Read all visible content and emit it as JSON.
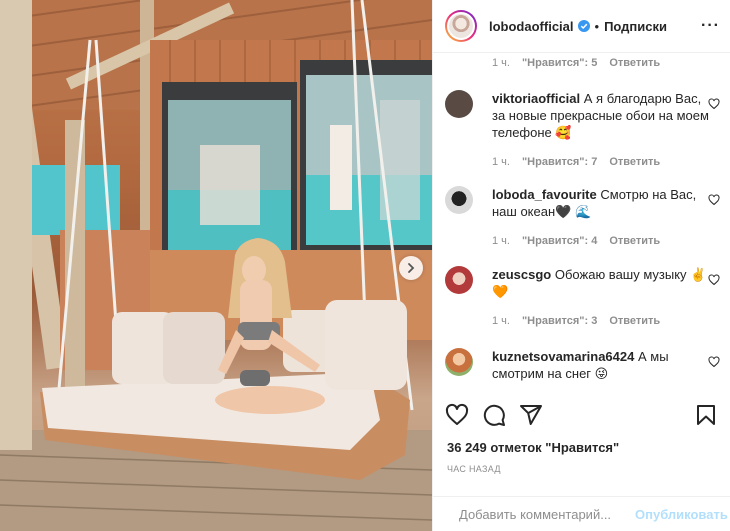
{
  "post": {
    "username": "lobodaofficial",
    "separator": "•",
    "follow_label": "Подписки",
    "more_label": "···"
  },
  "first_comment_meta": {
    "time": "1 ч.",
    "likes": "\"Нравится\": 5",
    "reply": "Ответить"
  },
  "comments": [
    {
      "username": "viktoriaofficial",
      "text": "А я благодарю Вас, за новые прекрасные обои на моем телефоне 🥰",
      "time": "1 ч.",
      "likes": "\"Нравится\": 7",
      "reply": "Ответить",
      "avatar_color": "#5a4a44"
    },
    {
      "username": "loboda_favourite",
      "text": "Смотрю на Вас, наш океан🖤 🌊",
      "time": "1 ч.",
      "likes": "\"Нравится\": 4",
      "reply": "Ответить",
      "avatar_color": "#d9d9d9"
    },
    {
      "username": "zeuscsgo",
      "text": "Обожаю вашу музыку ✌️🧡",
      "time": "1 ч.",
      "likes": "\"Нравится\": 3",
      "reply": "Ответить",
      "avatar_color": "#b23a3a"
    },
    {
      "username": "kuznetsovamarina6424",
      "text": "А мы смотрим на снег 😜",
      "time": "",
      "likes": "",
      "reply": "",
      "avatar_color": "#c8713f"
    }
  ],
  "likes_total": "36 249 отметок \"Нравится\"",
  "time_ago": "ЧАС НАЗАД",
  "add_comment": {
    "placeholder": "Добавить комментарий...",
    "publish_label": "Опубликовать"
  },
  "colors": {
    "verified": "#3897f0",
    "secondary_text": "#8e8e8e",
    "publish_disabled": "#b2dffc",
    "like_heart": "#262626"
  },
  "icons": [
    "verified-badge-icon",
    "heart-icon",
    "comment-icon",
    "share-icon",
    "bookmark-icon",
    "emoji-icon",
    "chevron-right-icon"
  ]
}
